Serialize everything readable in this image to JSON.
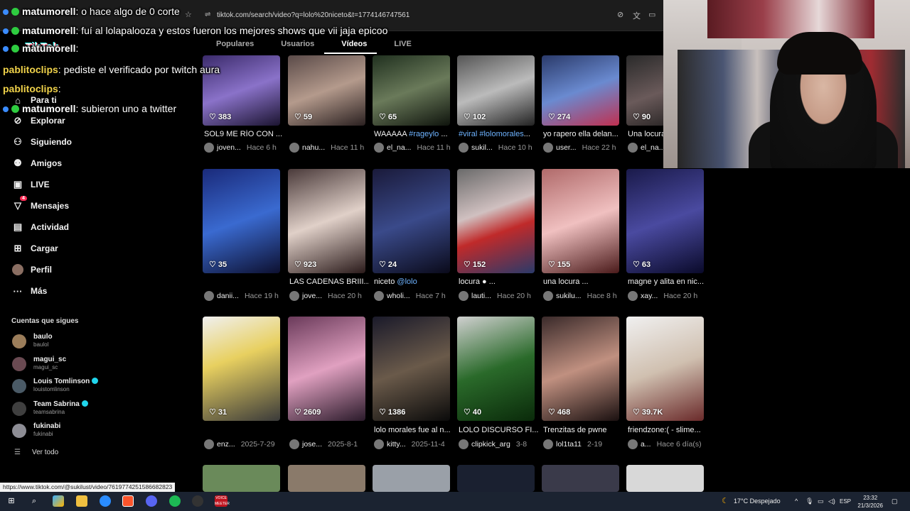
{
  "browser": {
    "url": "tiktok.com/search/video?q=lolo%20niceto&t=1774146747561"
  },
  "tabs": [
    {
      "label": "Populares",
      "active": false
    },
    {
      "label": "Usuarios",
      "active": false
    },
    {
      "label": "Vídeos",
      "active": true
    },
    {
      "label": "LIVE",
      "active": false
    }
  ],
  "sidebar": {
    "logo": "TikTok",
    "nav": [
      {
        "label": "Para ti",
        "icon": "home-icon"
      },
      {
        "label": "Explorar",
        "icon": "compass-icon"
      },
      {
        "label": "Siguiendo",
        "icon": "user-follow-icon"
      },
      {
        "label": "Amigos",
        "icon": "friends-icon"
      },
      {
        "label": "LIVE",
        "icon": "live-icon"
      },
      {
        "label": "Mensajes",
        "icon": "messages-icon",
        "badge": "4"
      },
      {
        "label": "Actividad",
        "icon": "activity-icon"
      },
      {
        "label": "Cargar",
        "icon": "upload-icon"
      },
      {
        "label": "Perfil",
        "icon": "profile-icon"
      },
      {
        "label": "Más",
        "icon": "more-icon"
      }
    ],
    "following_header": "Cuentas que sigues",
    "following": [
      {
        "name": "baulo",
        "user": "baulol",
        "verified": false
      },
      {
        "name": "magui_sc",
        "user": "magui_sc",
        "verified": false
      },
      {
        "name": "Louis Tomlinson",
        "user": "louistomlinson",
        "verified": true
      },
      {
        "name": "Team Sabrina",
        "user": "teamsabrina",
        "verified": true
      },
      {
        "name": "fukinabi",
        "user": "fukinabi",
        "verified": false
      }
    ],
    "see_all": "Ver todo"
  },
  "chat": [
    {
      "user": "matumorell",
      "msg": ": o hace algo de 0 corte",
      "color": "m"
    },
    {
      "user": "matumorell",
      "msg": ": fuí al lolapalooza y estos fueron los mejores shows que vii jaja epicoo",
      "color": "m"
    },
    {
      "user": "matumorell",
      "msg": ":",
      "color": "m"
    },
    {
      "user": "pablitoclips",
      "msg": ": pediste el verificado por twitch aura",
      "color": "p"
    },
    {
      "user": "pablitoclips",
      "msg": ":",
      "color": "p"
    },
    {
      "user": "matumorell",
      "msg": ": subieron uno a twitter",
      "color": "m"
    }
  ],
  "videos": [
    {
      "likes": "383",
      "title": "SOL9 ME RÍO CON ...",
      "author": "joven...",
      "time": "Hace 6 h"
    },
    {
      "likes": "59",
      "title": "",
      "author": "nahu...",
      "time": "Hace 11 h"
    },
    {
      "likes": "65",
      "title": "WAAAAA #rageylo ...",
      "author": "el_na...",
      "time": "Hace 11 h"
    },
    {
      "likes": "102",
      "title": "#viral #lolomorales...",
      "author": "sukil...",
      "time": "Hace 10 h"
    },
    {
      "likes": "274",
      "title": "yo rapero ella delan...",
      "author": "user...",
      "time": "Hace 22 h"
    },
    {
      "likes": "90",
      "title": "Una locura",
      "author": "el_na...",
      "time": ""
    },
    {
      "likes": "35",
      "title": "",
      "author": "danii...",
      "time": "Hace 19 h"
    },
    {
      "likes": "923",
      "title": "LAS CADENAS BRIII...",
      "author": "jove...",
      "time": "Hace 20 h"
    },
    {
      "likes": "24",
      "title": "niceto @lolo",
      "author": "wholi...",
      "time": "Hace 7 h"
    },
    {
      "likes": "152",
      "title": "locura ● ...",
      "author": "lauti...",
      "time": "Hace 20 h"
    },
    {
      "likes": "155",
      "title": "una locura ...",
      "author": "sukilu...",
      "time": "Hace 8 h"
    },
    {
      "likes": "63",
      "title": "magne y alita en nic...",
      "author": "xay...",
      "time": "Hace 20 h"
    },
    {
      "likes": "31",
      "title": "",
      "author": "enz...",
      "time": "2025-7-29"
    },
    {
      "likes": "2609",
      "title": "",
      "author": "jose...",
      "time": "2025-8-1"
    },
    {
      "likes": "1386",
      "title": "lolo morales fue al n...",
      "author": "kitty...",
      "time": "2025-11-4"
    },
    {
      "likes": "40",
      "title": "LOLO DISCURSO FI...",
      "author": "clipkick_arg",
      "time": "3-8"
    },
    {
      "likes": "468",
      "title": "Trenzitas de pwne",
      "author": "lol1ta11",
      "time": "2-19"
    },
    {
      "likes": "39.7K",
      "title": "friendzone:( - slime...",
      "author": "a...",
      "time": "Hace 6 día(s)"
    }
  ],
  "status_url": "https://www.tiktok.com/@sukilust/video/7619774251586682823",
  "taskbar": {
    "weather": "17°C  Despejado",
    "lang": "ESP",
    "time": "23:32",
    "date": "21/3/2026",
    "clip_label": "VOICE MEETER"
  }
}
